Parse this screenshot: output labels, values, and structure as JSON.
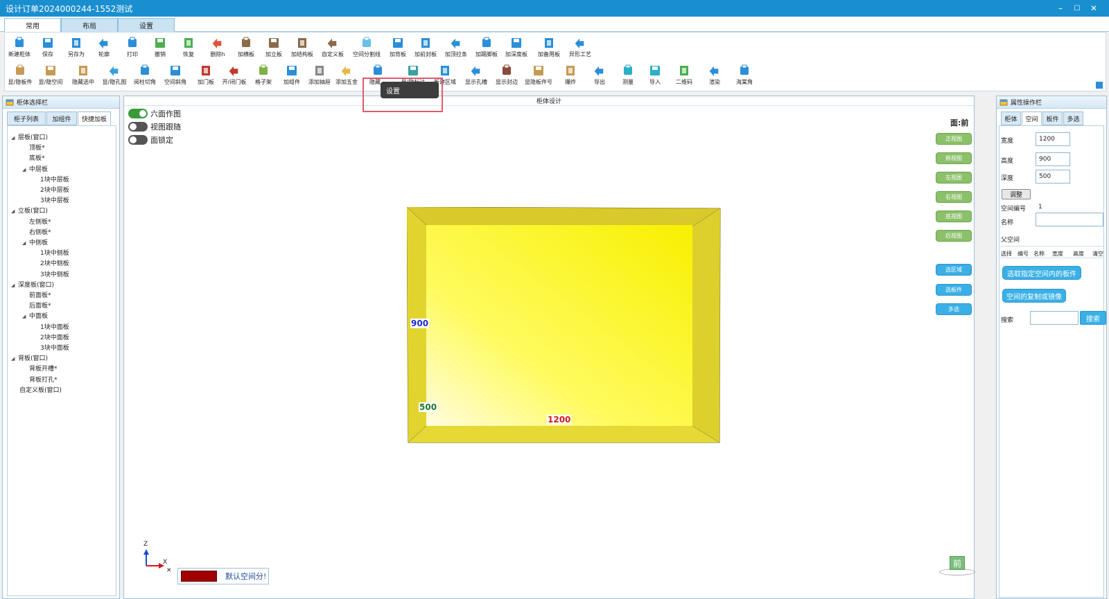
{
  "window": {
    "title": "设计订单2024000244-1552测试",
    "minimize": "–",
    "maximize": "☐",
    "close": "✕"
  },
  "tabs": [
    {
      "label": "常用"
    },
    {
      "label": "布局"
    },
    {
      "label": "设置"
    }
  ],
  "toolbar_row1": [
    {
      "label": "新建柜体",
      "icon": "new-cabinet-icon",
      "color": "#2a8fd8"
    },
    {
      "label": "保存",
      "icon": "save-icon",
      "color": "#2a8fd8"
    },
    {
      "label": "另存为",
      "icon": "save-as-icon",
      "color": "#2a8fd8"
    },
    {
      "label": "轮廓",
      "icon": "outline-icon",
      "color": "#2a8fd8"
    },
    {
      "label": "打印",
      "icon": "print-icon",
      "color": "#2a8fd8"
    },
    {
      "label": "撤销",
      "icon": "undo-icon",
      "color": "#4caf50"
    },
    {
      "label": "恢复",
      "icon": "redo-icon",
      "color": "#4caf50"
    },
    {
      "label": "删除h",
      "icon": "delete-icon",
      "color": "#e0523a"
    },
    {
      "label": "加横板",
      "icon": "add-horizontal-board-icon",
      "color": "#8a6a4a"
    },
    {
      "label": "加立板",
      "icon": "add-vertical-board-icon",
      "color": "#8a6a4a"
    },
    {
      "label": "加结构板",
      "icon": "add-structure-board-icon",
      "color": "#8a6a4a"
    },
    {
      "label": "自定义板",
      "icon": "custom-board-icon",
      "color": "#8a6a4a"
    },
    {
      "label": "空间分割线",
      "icon": "space-divider-icon",
      "color": "#6ac0e8"
    },
    {
      "label": "加背板",
      "icon": "add-back-board-icon",
      "color": "#2a8fd8"
    },
    {
      "label": "加前封板",
      "icon": "add-front-seal-icon",
      "color": "#2a8fd8"
    },
    {
      "label": "加顶拉条",
      "icon": "add-top-strip-icon",
      "color": "#2a8fd8"
    },
    {
      "label": "加踢脚板",
      "icon": "add-skirting-icon",
      "color": "#2a8fd8"
    },
    {
      "label": "加深度板",
      "icon": "add-depth-board-icon",
      "color": "#2a8fd8"
    },
    {
      "label": "加备用板",
      "icon": "add-spare-board-icon",
      "color": "#2a8fd8"
    },
    {
      "label": "异形工艺",
      "icon": "special-process-icon",
      "color": "#2a8fd8"
    }
  ],
  "toolbar_row2": [
    {
      "label": "显/隐板件",
      "icon": "toggle-boards-icon",
      "color": "#c69a55"
    },
    {
      "label": "显/隐空间",
      "icon": "toggle-space-icon",
      "color": "#c69a55"
    },
    {
      "label": "隐藏选中",
      "icon": "hide-selected-icon",
      "color": "#c69a55"
    },
    {
      "label": "显/隐孔图",
      "icon": "toggle-holes-icon",
      "color": "#3aa0d8"
    },
    {
      "label": "阅柱切角",
      "icon": "column-chamfer-icon",
      "color": "#2a8fd8"
    },
    {
      "label": "空间斜角",
      "icon": "space-bevel-icon",
      "color": "#2a8fd8"
    },
    {
      "label": "加门板",
      "icon": "add-door-icon",
      "color": "#c0392b"
    },
    {
      "label": "开/闭门板",
      "icon": "open-close-door-icon",
      "color": "#c0392b"
    },
    {
      "label": "格子架",
      "icon": "grid-rack-icon",
      "color": "#7cb342"
    },
    {
      "label": "加组件",
      "icon": "add-component-icon",
      "color": "#2a8fd8"
    },
    {
      "label": "添加抽屉",
      "icon": "add-drawer-icon",
      "color": "#888888"
    },
    {
      "label": "添加五金",
      "icon": "add-hardware-icon",
      "color": "#e6b94a"
    },
    {
      "label": "隐藏…",
      "icon": "hide-icon",
      "color": "#2a8fd8"
    },
    {
      "label": "显/隐标注",
      "icon": "toggle-dimension-icon",
      "color": "#3aa0a0"
    },
    {
      "label": "新建区域",
      "icon": "new-region-icon",
      "color": "#2a8fd8"
    },
    {
      "label": "显示孔槽",
      "icon": "show-holes-icon",
      "color": "#2a8fd8"
    },
    {
      "label": "显示封边",
      "icon": "show-edge-band-icon",
      "color": "#8a4a3a"
    },
    {
      "label": "显隐板件号",
      "icon": "toggle-board-number-icon",
      "color": "#c69a55"
    },
    {
      "label": "爆炸",
      "icon": "explode-icon",
      "color": "#c69a55"
    },
    {
      "label": "导出",
      "icon": "export-icon",
      "color": "#2a8fd8"
    },
    {
      "label": "测量",
      "icon": "measure-icon",
      "color": "#2ab0c8"
    },
    {
      "label": "导入",
      "icon": "import-icon",
      "color": "#2ab0c8"
    },
    {
      "label": "二维码",
      "icon": "qr-cloud-icon",
      "color": "#4caf50"
    },
    {
      "label": "渲染",
      "icon": "render-icon",
      "color": "#2a8fd8"
    },
    {
      "label": "海棠角",
      "icon": "begonia-corner-icon",
      "color": "#2a8fd8"
    }
  ],
  "tooltip": "设置",
  "left_panel": {
    "title": "柜体选择栏",
    "tabs": [
      "柜子列表",
      "加组件",
      "快捷加板"
    ],
    "tree": [
      {
        "label": "层板(窗口)",
        "arrow": "◢"
      },
      {
        "label": "顶板*"
      },
      {
        "label": "底板*"
      },
      {
        "label": "中层板",
        "arrow": "◢"
      },
      {
        "label": "1块中层板"
      },
      {
        "label": "2块中层板"
      },
      {
        "label": "3块中层板"
      },
      {
        "label": "立板(窗口)",
        "arrow": "◢"
      },
      {
        "label": "左侧板*"
      },
      {
        "label": "右侧板*"
      },
      {
        "label": "中侧板",
        "arrow": "◢"
      },
      {
        "label": "1块中侧板"
      },
      {
        "label": "2块中侧板"
      },
      {
        "label": "3块中侧板"
      },
      {
        "label": "深度板(窗口)",
        "arrow": "◢"
      },
      {
        "label": "前面板*"
      },
      {
        "label": "后面板*"
      },
      {
        "label": "中面板",
        "arrow": "◢"
      },
      {
        "label": "1块中面板"
      },
      {
        "label": "2块中面板"
      },
      {
        "label": "3块中面板"
      },
      {
        "label": "背板(窗口)",
        "arrow": "◢"
      },
      {
        "label": "背板开槽*"
      },
      {
        "label": "背板打孔*"
      },
      {
        "label": "自定义板(窗口)"
      }
    ]
  },
  "canvas": {
    "title": "柜体设计",
    "toggles": [
      {
        "label": "六面作图",
        "on": true
      },
      {
        "label": "视图跟随",
        "on": false
      },
      {
        "label": "面锁定",
        "on": false
      }
    ],
    "face_label": "面:前",
    "view_buttons": [
      "正视图",
      "俯视图",
      "左视图",
      "右视图",
      "底视图",
      "后视图"
    ],
    "select_buttons": [
      "选区域",
      "选板件",
      "多选"
    ],
    "dims": {
      "height": "900",
      "depth": "500",
      "width": "1200"
    },
    "axes": {
      "z": "Z",
      "x": "X"
    },
    "status_chip": "默认空间分!",
    "status_color": "#a00000",
    "front_cube": "前",
    "cabinet_color": "#f5e63a"
  },
  "right_panel": {
    "title": "属性操作栏",
    "tabs": [
      "柜体",
      "空间",
      "板件",
      "多选"
    ],
    "width_label": "宽度",
    "width_value": "1200",
    "height_label": "高度",
    "height_value": "900",
    "depth_label": "深度",
    "depth_value": "500",
    "adjust_button": "调整",
    "space_no_label": "空间编号",
    "space_no_value": "1",
    "name_label": "名称",
    "name_value": "",
    "parent_label": "父空间",
    "columns": [
      "选择",
      "编号",
      "名称",
      "宽度",
      "高度",
      "清空"
    ],
    "select_boards_button": "选取指定空间内的板件",
    "copy_mirror_button": "空间的复制或镜像",
    "search_label": "搜索",
    "search_value": "",
    "search_button": "搜索"
  }
}
